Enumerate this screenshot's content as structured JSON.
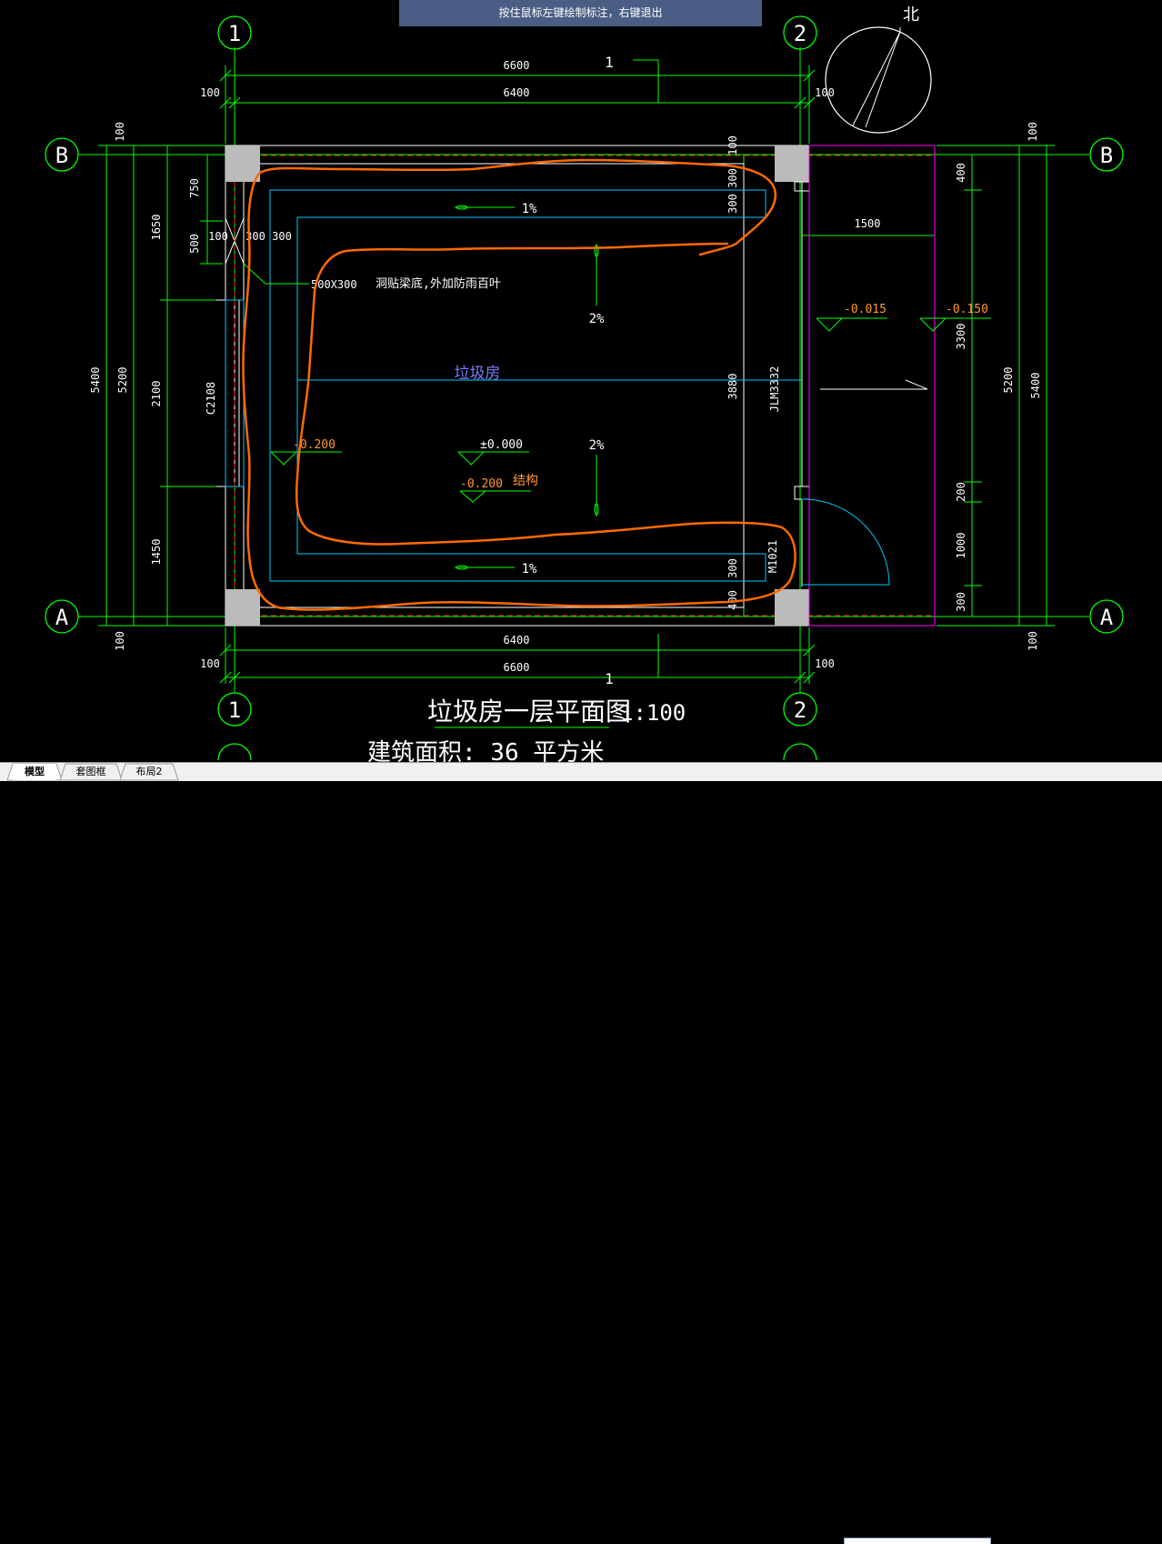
{
  "hint": "按住鼠标左键绘制标注，右键退出",
  "tabs": [
    {
      "label": "模型",
      "active": true
    },
    {
      "label": "套图框",
      "active": false
    },
    {
      "label": "布局2",
      "active": false
    }
  ],
  "axes": {
    "v1": "1",
    "v2": "2",
    "hA": "A",
    "hB": "B",
    "north": "北"
  },
  "dims": {
    "top_total": "6600",
    "top_inner": "6400",
    "top_side": "100",
    "top_marker": "1",
    "bottom_inner": "6400",
    "bottom_total": "6600",
    "bottom_side": "100",
    "bottom_marker": "1",
    "left_total": "5400",
    "left_inner": "5200",
    "left_100": "100",
    "left_1650": "1650",
    "left_2100": "2100",
    "left_1450": "1450",
    "left_750": "750",
    "left_500": "500",
    "right_total": "5400",
    "right_inner": "5200",
    "right_100": "100",
    "right_400": "400",
    "right_3300": "3300",
    "right_200": "200",
    "right_1000": "1000",
    "right_300": "300",
    "dim_1500": "1500",
    "dim_100a": "100",
    "dim_300a": "300",
    "dim_300b": "300",
    "dim_300c": "300",
    "dim_300d": "300",
    "dim_3880": "3880",
    "dim_400": "400",
    "dim_100b": "100"
  },
  "labels": {
    "room": "垃圾房",
    "slope_top": "1%",
    "slope_bottom": "1%",
    "slope_mid1": "2%",
    "slope_mid2": "2%",
    "opening_size": "500X300",
    "opening_note": "洞贴梁底,外加防雨百叶",
    "elev_0": "±0.000",
    "elev_m200a": "-0.200",
    "elev_m200b": "-0.200",
    "structure": "结构",
    "elev_m015": "-0.015",
    "elev_m150": "-0.150",
    "window": "C2108",
    "door_roll": "JLM3332",
    "door": "M1021",
    "title": "垃圾房一层平面图",
    "scale": "1:100",
    "area": "建筑面积: 36  平方米"
  },
  "colors": {
    "dim": "#00ff00",
    "axis": "#00ff00",
    "wall": "#ffffff",
    "inner": "#00c8ff",
    "sketch": "#ff6a00",
    "purple": "#ff00ff",
    "text_orange": "#ff9933",
    "room": "#7b7bff",
    "hint_bg": "#4a5e85"
  }
}
